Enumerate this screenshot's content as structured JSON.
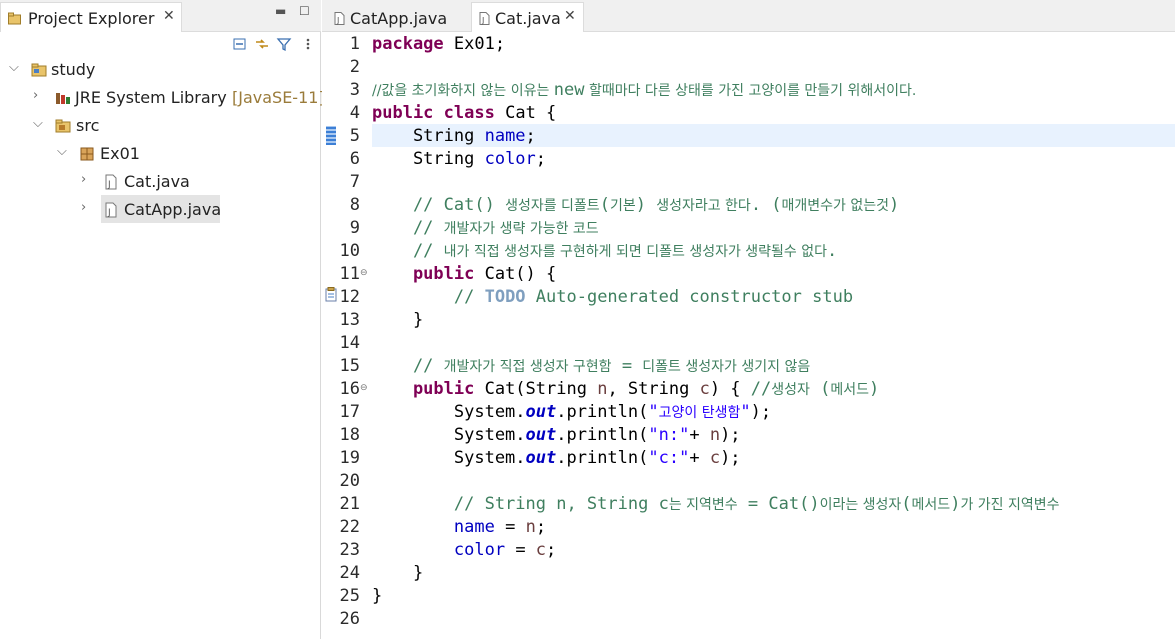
{
  "explorer": {
    "tab_title": "Project Explorer",
    "close_glyph": "✕",
    "minimize_glyph": "▬",
    "maximize_glyph": "☐",
    "toolbar_icons": [
      "collapse-all-icon",
      "link-with-editor-icon",
      "filter-icon",
      "view-menu-icon"
    ],
    "tree": {
      "project": "study",
      "jre_label": "JRE System Library",
      "jre_decoration": "[JavaSE-11]",
      "src": "src",
      "package": "Ex01",
      "files": [
        "Cat.java",
        "CatApp.java"
      ]
    }
  },
  "editor": {
    "tabs": [
      {
        "label": "CatApp.java",
        "active": false
      },
      {
        "label": "Cat.java",
        "active": true
      }
    ],
    "close_glyph": "✕",
    "line_numbers": [
      "1",
      "2",
      "3",
      "4",
      "5",
      "6",
      "7",
      "8",
      "9",
      "10",
      "11",
      "12",
      "13",
      "14",
      "15",
      "16",
      "17",
      "18",
      "19",
      "20",
      "21",
      "22",
      "23",
      "24",
      "25",
      "26"
    ],
    "code": {
      "l1_kw": "package",
      "l1_rest": " Ex01;",
      "l3_a": "//값을 초기화하지 않는 이유는 ",
      "l3_b": "new",
      "l3_c": " 할때마다 다른 상태를 가진 고양이를 만들기 위해서이다.",
      "l4_kw1": "public",
      "l4_kw2": "class",
      "l4_rest": " Cat {",
      "l5_type": "    String ",
      "l5_field": "name",
      "l5_end": ";",
      "l6_type": "    String ",
      "l6_field": "color",
      "l6_end": ";",
      "l8_a": "    // Cat() ",
      "l8_b": "생성자를 디폴트",
      "l8_c": "(",
      "l8_d": "기본",
      "l8_e": ") ",
      "l8_f": "생성자라고 한다",
      "l8_g": ". (",
      "l8_h": "매개변수가 없는것",
      "l8_i": ")",
      "l9_a": "    // ",
      "l9_b": "개발자가 생략 가능한 코드",
      "l10_a": "    // ",
      "l10_b": "내가 직접 생성자를 구현하게 되면 디폴트 생성자가 생략될수 없다",
      "l10_c": ".",
      "l11_kw": "    public",
      "l11_rest": " Cat() {",
      "l12_a": "        // ",
      "l12_todo": "TODO",
      "l12_b": " Auto-generated constructor stub",
      "l13": "    }",
      "l15_a": "    // ",
      "l15_b": "개발자가 직접 생성자 구현함",
      "l15_c": " = ",
      "l15_d": "디폴트 생성자가 생기지 않음",
      "l16_kw": "    public",
      "l16_a": " Cat(String ",
      "l16_n": "n",
      "l16_b": ", String ",
      "l16_c": "c",
      "l16_d": ") { ",
      "l16_e": "//",
      "l16_f": "생성자",
      "l16_g": " (",
      "l16_h": "메서드",
      "l16_i": ")",
      "l17_a": "        System.",
      "l17_out": "out",
      "l17_b": ".println(",
      "l17_str_q1": "\"",
      "l17_str": "고양이 탄생함",
      "l17_str_q2": "\"",
      "l17_c": ");",
      "l18_a": "        System.",
      "l18_out": "out",
      "l18_b": ".println(",
      "l18_str": "\"n:\"",
      "l18_c": "+ ",
      "l18_v": "n",
      "l18_d": ");",
      "l19_a": "        System.",
      "l19_out": "out",
      "l19_b": ".println(",
      "l19_str": "\"c:\"",
      "l19_c": "+ ",
      "l19_v": "c",
      "l19_d": ");",
      "l21_a": "        // String n, String c",
      "l21_b": "는 지역변수",
      "l21_c": " = Cat()",
      "l21_d": "이라는 생성자",
      "l21_e": "(",
      "l21_f": "메서드",
      "l21_g": ")",
      "l21_h": "가 가진 지역변수",
      "l22_sp": "        ",
      "l22_f": "name",
      "l22_a": " = ",
      "l22_v": "n",
      "l22_e": ";",
      "l23_sp": "        ",
      "l23_f": "color",
      "l23_a": " = ",
      "l23_v": "c",
      "l23_e": ";",
      "l24": "    }",
      "l25": "}"
    }
  }
}
